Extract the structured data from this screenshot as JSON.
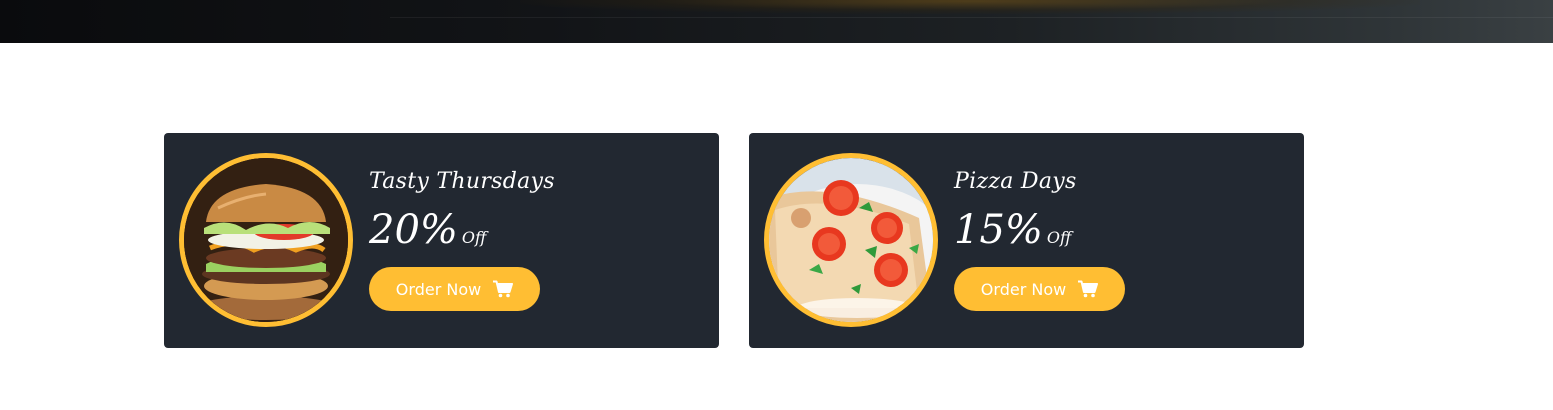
{
  "offers": [
    {
      "title": "Tasty Thursdays",
      "percent": "20%",
      "off_label": "Off",
      "button_label": "Order Now",
      "image": "burger-image",
      "icon": "cart-icon"
    },
    {
      "title": "Pizza Days",
      "percent": "15%",
      "off_label": "Off",
      "button_label": "Order Now",
      "image": "pizza-image",
      "icon": "cart-icon"
    }
  ],
  "colors": {
    "accent": "#ffbe33",
    "card_bg": "#222831",
    "text": "#ffffff"
  }
}
